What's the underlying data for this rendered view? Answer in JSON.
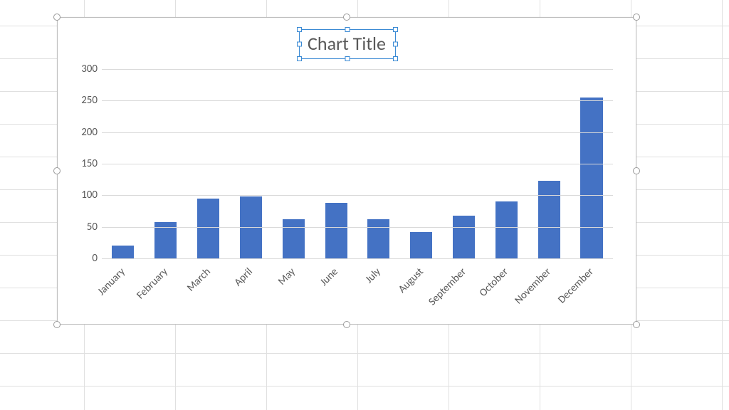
{
  "chart_data": {
    "type": "bar",
    "title": "Chart Title",
    "xlabel": "",
    "ylabel": "",
    "ylim": [
      0,
      300
    ],
    "yticks": [
      0,
      50,
      100,
      150,
      200,
      250,
      300
    ],
    "categories": [
      "January",
      "February",
      "March",
      "April",
      "May",
      "June",
      "July",
      "August",
      "September",
      "October",
      "November",
      "December"
    ],
    "values": [
      20,
      57,
      95,
      98,
      62,
      88,
      62,
      42,
      68,
      90,
      123,
      255
    ],
    "bar_color": "#4472c4"
  }
}
